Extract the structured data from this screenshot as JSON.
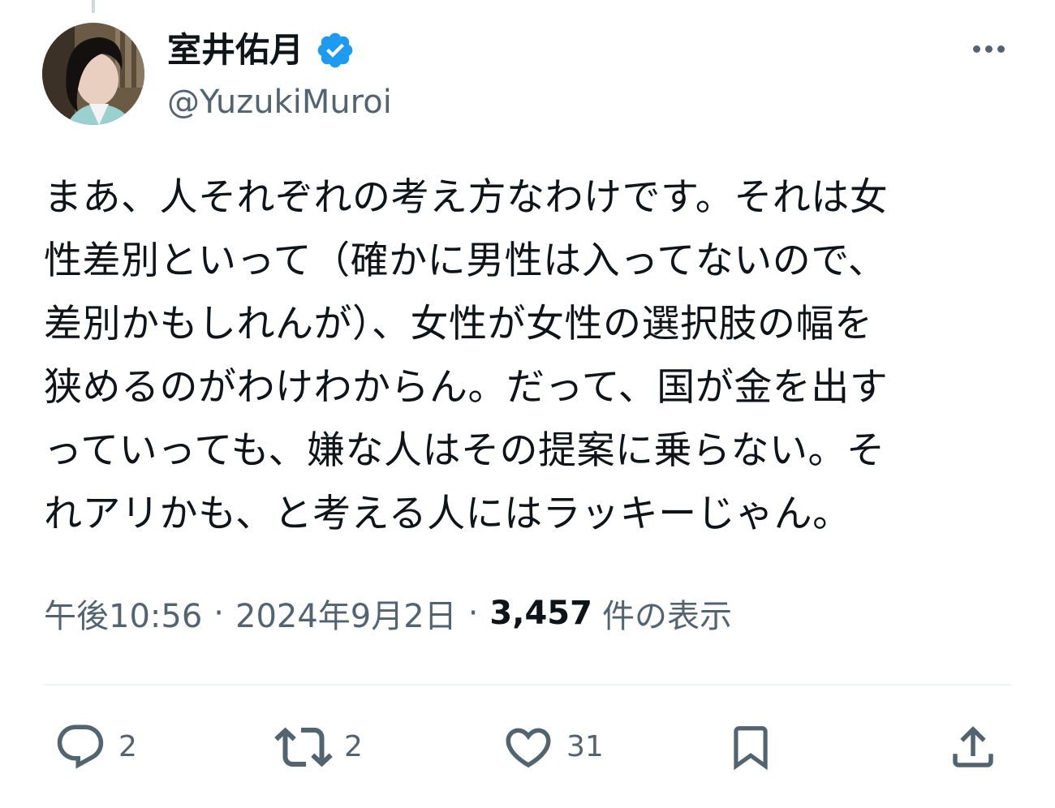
{
  "tweet": {
    "author": {
      "name": "室井佑月",
      "handle": "@YuzukiMuroi",
      "verified": true,
      "avatar": "profile-photo"
    },
    "text_lines": [
      "まあ、人それぞれの考え方なわけです。それは女",
      "性差別といって（確かに男性は入ってないので、",
      "差別かもしれんが）、女性が女性の選択肢の幅を",
      "狭めるのがわけわからん。だって、国が金を出す",
      "っていっても、嫌な人はその提案に乗らない。そ",
      "れアリかも、と考える人にはラッキーじゃん。"
    ],
    "time": "午後10:56",
    "date": "2024年9月2日",
    "separator": "·",
    "views_count": "3,457",
    "views_label": "件の表示"
  },
  "actions": {
    "reply": {
      "icon": "reply-icon",
      "count": "2"
    },
    "repost": {
      "icon": "repost-icon",
      "count": "2"
    },
    "like": {
      "icon": "heart-icon",
      "count": "31"
    },
    "bookmark": {
      "icon": "bookmark-icon"
    },
    "share": {
      "icon": "share-icon"
    }
  },
  "colors": {
    "text_primary": "#0f1419",
    "text_secondary": "#536471",
    "verified_blue": "#1d9bf0",
    "divider": "#eff3f4"
  }
}
